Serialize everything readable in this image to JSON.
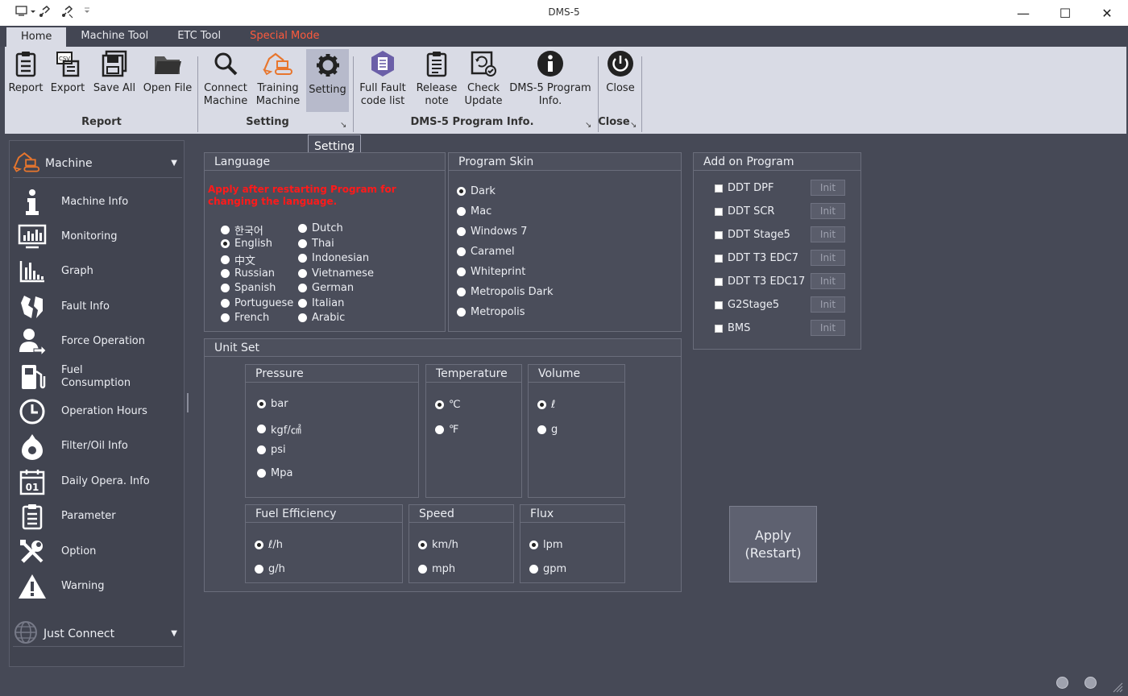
{
  "window": {
    "title": "DMS-5",
    "minimize": "—",
    "maximize": "☐",
    "close": "✕"
  },
  "tabs": [
    {
      "label": "Home",
      "active": true
    },
    {
      "label": "Machine Tool"
    },
    {
      "label": "ETC Tool"
    },
    {
      "label": "Special Mode",
      "color": "#ff5a3c"
    }
  ],
  "ribbon": {
    "buttons": [
      {
        "label": "Report",
        "icon": "clipboard-report-icon"
      },
      {
        "label": "Export",
        "icon": "csv-export-icon",
        "icon_text": "CSV"
      },
      {
        "label": "Save All",
        "icon": "floppy-disk-icon"
      },
      {
        "label": "Open File",
        "icon": "folder-icon"
      },
      {
        "label": "Connect\nMachine",
        "icon": "magnifier-icon"
      },
      {
        "label": "Training\nMachine",
        "icon": "excavator-icon"
      },
      {
        "label": "Setting",
        "icon": "gear-icon"
      },
      {
        "label": "Full Fault\ncode list",
        "icon": "fault-code-icon"
      },
      {
        "label": "Release\nnote",
        "icon": "release-note-icon"
      },
      {
        "label": "Check\nUpdate",
        "icon": "check-update-icon"
      },
      {
        "label": "DMS-5 Program\nInfo.",
        "icon": "info-icon"
      },
      {
        "label": "Close",
        "icon": "power-icon"
      }
    ],
    "groups": [
      "Report",
      "Setting",
      "DMS-5 Program Info.",
      "Close"
    ],
    "tooltip": "Setting"
  },
  "sidebar": {
    "header": "Machine",
    "items": [
      {
        "label": "Machine Info",
        "icon": "info-icon"
      },
      {
        "label": "Monitoring",
        "icon": "monitor-chart-icon"
      },
      {
        "label": "Graph",
        "icon": "bar-graph-icon"
      },
      {
        "label": "Fault Info",
        "icon": "broken-part-icon"
      },
      {
        "label": "Force Operation",
        "icon": "user-arrow-icon"
      },
      {
        "label": "Fuel\nConsumption",
        "icon": "fuel-pump-icon"
      },
      {
        "label": "Operation Hours",
        "icon": "clock-icon"
      },
      {
        "label": "Filter/Oil Info",
        "icon": "oil-drop-icon"
      },
      {
        "label": "Daily Opera. Info",
        "icon": "calendar-icon",
        "icon_text": "01"
      },
      {
        "label": "Parameter",
        "icon": "parameter-list-icon"
      },
      {
        "label": "Option",
        "icon": "tools-icon"
      },
      {
        "label": "Warning",
        "icon": "warning-icon"
      }
    ],
    "footer": "Just Connect"
  },
  "language": {
    "title": "Language",
    "warning": "Apply after restarting Program for changing the language.",
    "options_col1": [
      "한국어",
      "English",
      "中文",
      "Russian",
      "Spanish",
      "Portuguese",
      "French"
    ],
    "options_col2": [
      "Dutch",
      "Thai",
      "Indonesian",
      "Vietnamese",
      "German",
      "Italian",
      "Arabic"
    ],
    "selected": "English"
  },
  "skin": {
    "title": "Program Skin",
    "options": [
      "Dark",
      "Mac",
      "Windows 7",
      "Caramel",
      "Whiteprint",
      "Metropolis Dark",
      "Metropolis"
    ],
    "selected": "Dark"
  },
  "addon": {
    "title": "Add on Program",
    "items": [
      "DDT DPF",
      "DDT SCR",
      "DDT Stage5",
      "DDT T3 EDC7",
      "DDT T3 EDC17",
      "G2Stage5",
      "BMS"
    ],
    "init_label": "Init"
  },
  "unit_set": {
    "title": "Unit Set",
    "pressure": {
      "title": "Pressure",
      "options": [
        "bar",
        "kgf/㎠",
        "psi",
        "Mpa"
      ],
      "selected": "bar"
    },
    "temperature": {
      "title": "Temperature",
      "options": [
        "℃",
        "℉"
      ],
      "selected": "℃"
    },
    "volume": {
      "title": "Volume",
      "options": [
        "ℓ",
        "g"
      ],
      "selected": "ℓ"
    },
    "fuel_efficiency": {
      "title": "Fuel Efficiency",
      "options": [
        "ℓ/h",
        "g/h"
      ],
      "selected": "ℓ/h"
    },
    "speed": {
      "title": "Speed",
      "options": [
        "km/h",
        "mph"
      ],
      "selected": "km/h"
    },
    "flux": {
      "title": "Flux",
      "options": [
        "lpm",
        "gpm"
      ],
      "selected": "lpm"
    }
  },
  "apply_button": {
    "line1": "Apply",
    "line2": "(Restart)"
  }
}
